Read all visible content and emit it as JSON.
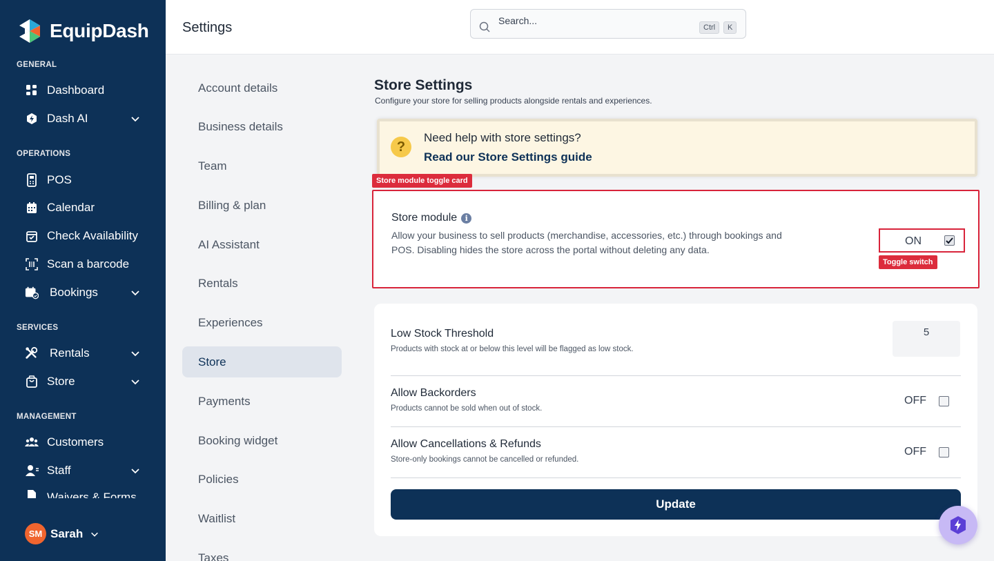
{
  "app": {
    "brand": "EquipDash",
    "page_title": "Settings"
  },
  "search": {
    "placeholder": "Search...",
    "shortcut_1": "Ctrl",
    "shortcut_2": "K"
  },
  "sidebar": {
    "sections": {
      "general": "GENERAL",
      "operations": "OPERATIONS",
      "services": "SERVICES",
      "management": "MANAGEMENT"
    },
    "items": {
      "dashboard": "Dashboard",
      "dash_ai": "Dash AI",
      "pos": "POS",
      "calendar": "Calendar",
      "check_availability": "Check Availability",
      "scan_barcode": "Scan a barcode",
      "bookings": "Bookings",
      "rentals": "Rentals",
      "store": "Store",
      "customers": "Customers",
      "staff": "Staff",
      "waivers": "Waivers & Forms"
    },
    "user": {
      "initials": "SM",
      "name": "Sarah"
    }
  },
  "settings_menu": [
    "Account details",
    "Business details",
    "Team",
    "Billing & plan",
    "AI Assistant",
    "Rentals",
    "Experiences",
    "Store",
    "Payments",
    "Booking widget",
    "Policies",
    "Waitlist",
    "Taxes"
  ],
  "active_menu": "Store",
  "store_settings": {
    "title": "Store Settings",
    "description": "Configure your store for selling products alongside rentals and experiences.",
    "help": {
      "question": "Need help with store settings?",
      "link": "Read our Store Settings guide"
    },
    "annotations": {
      "card": "Store module toggle card",
      "toggle": "Toggle switch"
    },
    "store_module": {
      "title": "Store module",
      "description": "Allow your business to sell products (merchandise, accessories, etc.) through bookings and POS. Disabling hides the store across the portal without deleting any data.",
      "state_label": "ON",
      "enabled": true
    },
    "low_stock": {
      "title": "Low Stock Threshold",
      "description": "Products with stock at or below this level will be flagged as low stock.",
      "value": "5"
    },
    "backorders": {
      "title": "Allow Backorders",
      "description": "Products cannot be sold when out of stock.",
      "state_label": "OFF"
    },
    "cancellations": {
      "title": "Allow Cancellations & Refunds",
      "description": "Store-only bookings cannot be cancelled or refunded.",
      "state_label": "OFF"
    },
    "update_label": "Update"
  },
  "colors": {
    "sidebar_bg": "#0d3157",
    "accent": "#0d3157",
    "annotation": "#dc2c3c",
    "help_bg": "#fdf6e3"
  }
}
